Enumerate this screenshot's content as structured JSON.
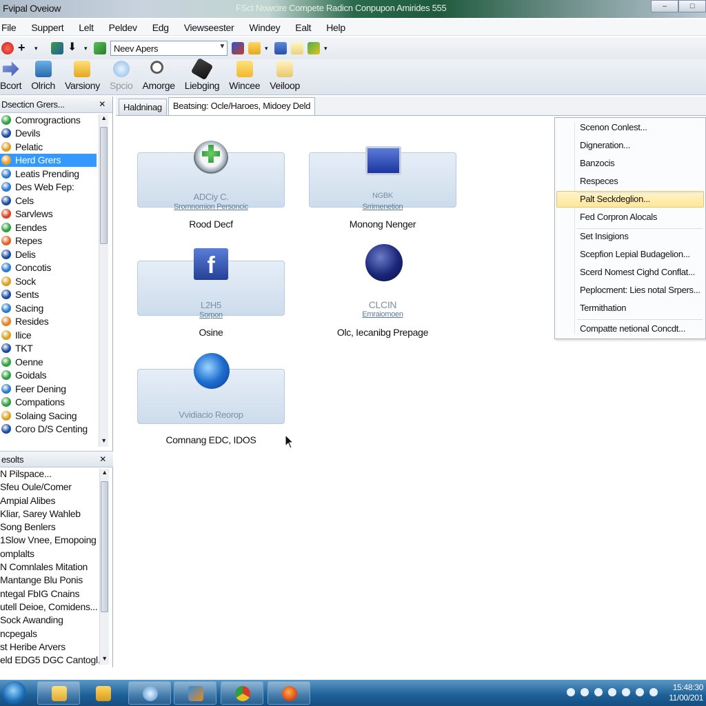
{
  "window": {
    "title": "Fvipal Oveiow",
    "caption": "FSct Nowcire Compete Radicn Conpupon Amirides 555"
  },
  "menubar": [
    "File",
    "Suppert",
    "Lelt",
    "Peldev",
    "Edg",
    "Viewseester",
    "Windey",
    "Ealt",
    "Help"
  ],
  "toolbar": {
    "combo_value": "Neev Apers"
  },
  "big_toolbar": [
    "Bcort",
    "Olrich",
    "Varsiony",
    "Spcio",
    "Amorge",
    "Liebging",
    "Wincee",
    "Veiloop"
  ],
  "left_pane": {
    "title": "Dsecticn Grers...",
    "close": "✕",
    "items": [
      {
        "label": "Comrogractions",
        "color": "#2e9e3e"
      },
      {
        "label": "Devils",
        "color": "#1a4aa0"
      },
      {
        "label": "Pelatic",
        "color": "#d8a020"
      },
      {
        "label": "Herd Grers",
        "color": "#f0a020",
        "selected": true
      },
      {
        "label": "Leatis Prending",
        "color": "#2a78c8"
      },
      {
        "label": "Des Web Fep:",
        "color": "#2a78c8"
      },
      {
        "label": "Cels",
        "color": "#1a4aa0"
      },
      {
        "label": "Sarvlews",
        "color": "#d84020"
      },
      {
        "label": "Eendes",
        "color": "#2e9e3e"
      },
      {
        "label": "Repes",
        "color": "#e06020"
      },
      {
        "label": "Delis",
        "color": "#1a4aa0"
      },
      {
        "label": "Concotis",
        "color": "#2a78c8"
      },
      {
        "label": "Sock",
        "color": "#d8a020"
      },
      {
        "label": "Sents",
        "color": "#1a4aa0"
      },
      {
        "label": "Sacing",
        "color": "#2a78c8"
      },
      {
        "label": "Resides",
        "color": "#e08020"
      },
      {
        "label": "Ilice",
        "color": "#d8a020"
      },
      {
        "label": "TKT",
        "color": "#1a4aa0"
      },
      {
        "label": "Oenne",
        "color": "#2e9e3e"
      },
      {
        "label": "Goidals",
        "color": "#2e9e3e"
      },
      {
        "label": "Feer Dening",
        "color": "#2a78c8"
      },
      {
        "label": "Compations",
        "color": "#2e9e3e"
      },
      {
        "label": "Solaing Sacing",
        "color": "#d8a020"
      },
      {
        "label": "Coro D/S Centing",
        "color": "#1a4aa0"
      }
    ]
  },
  "lower_pane": {
    "title": "esolts",
    "close": "✕",
    "items": [
      "N Pilspace...",
      "Sfeu Oule/Comer",
      "Ampial Alibes",
      "Kliar, Sarey Wahleb",
      "Song Benlers",
      "1Slow Vnee, Emopoing",
      "omplalts",
      "N Comnlales Mitation",
      "Mantange Blu Ponis",
      "ntegal FbIG Cnains",
      "utell Deioe, Comidens...",
      "Sock Awanding",
      "ncpegals",
      "st Heribe Arvers",
      "eld EDG5 DGC Cantogl."
    ]
  },
  "tabs": [
    "Haldninag",
    "Beatsing: Ocle/Haroes, Midoey Deld"
  ],
  "cards": [
    {
      "big": "ADCiy C.",
      "small": "Sromnomion Personcic",
      "caption": "Rood Decf"
    },
    {
      "big": "NGBK",
      "small": "Srrimenetion",
      "caption": "Monong Nenger"
    },
    {
      "big": "L2H5",
      "small": "Sorpon",
      "caption": "Osine"
    },
    {
      "big": "CLCIN",
      "small": "Emraiomoen",
      "caption": "Olc, Iecanibg Prepage"
    },
    {
      "big": "Vvidiacio Reorop",
      "small": "",
      "caption": "Comnang EDC, IDOS"
    }
  ],
  "context_menu": [
    "Scenon Conlest...",
    "Digneration...",
    "Banzocis",
    "Respeces",
    "Palt Seckdeglion...",
    "Fed Corpron Alocals",
    "Set Insigions",
    "Scepfion Lepial Budagelion...",
    "Scerd Nomest Cighd Conflat...",
    "Peplocment: Lies notal Srpers...",
    "Termithation",
    "Compatte netional Concdt..."
  ],
  "tray": {
    "time": "15:48:30",
    "date": "11/00/201"
  }
}
